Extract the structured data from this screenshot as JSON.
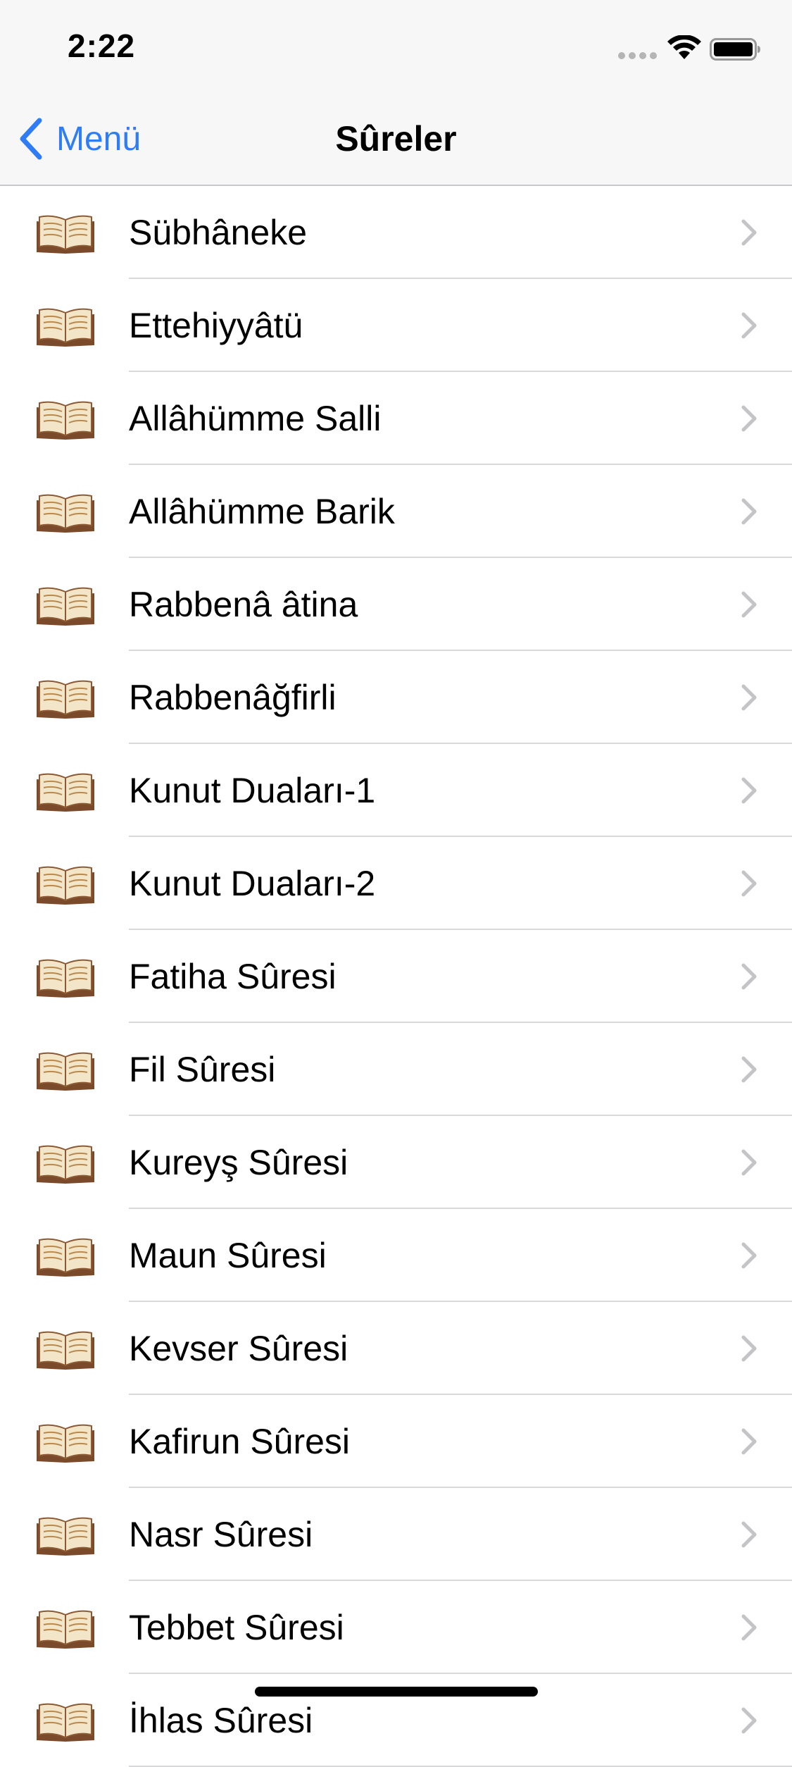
{
  "status_bar": {
    "time": "2:22"
  },
  "nav": {
    "back_label": "Menü",
    "title": "Sûreler"
  },
  "list": {
    "items": [
      {
        "label": "Sübhâneke"
      },
      {
        "label": "Ettehiyyâtü"
      },
      {
        "label": "Allâhümme Salli"
      },
      {
        "label": "Allâhümme Barik"
      },
      {
        "label": "Rabbenâ âtina"
      },
      {
        "label": "Rabbenâğfirli"
      },
      {
        "label": "Kunut Duaları-1"
      },
      {
        "label": "Kunut Duaları-2"
      },
      {
        "label": "Fatiha Sûresi"
      },
      {
        "label": "Fil Sûresi"
      },
      {
        "label": "Kureyş Sûresi"
      },
      {
        "label": "Maun Sûresi"
      },
      {
        "label": "Kevser Sûresi"
      },
      {
        "label": "Kafirun Sûresi"
      },
      {
        "label": "Nasr Sûresi"
      },
      {
        "label": "Tebbet Sûresi"
      },
      {
        "label": "İhlas Sûresi"
      }
    ],
    "item_icon": "open-book-icon",
    "accessory_icon": "chevron-right-icon"
  },
  "colors": {
    "accent": "#2f7df6",
    "bar_background": "#f7f7f7",
    "separator": "#d9d9dc",
    "chevron": "#c4c4c7"
  }
}
